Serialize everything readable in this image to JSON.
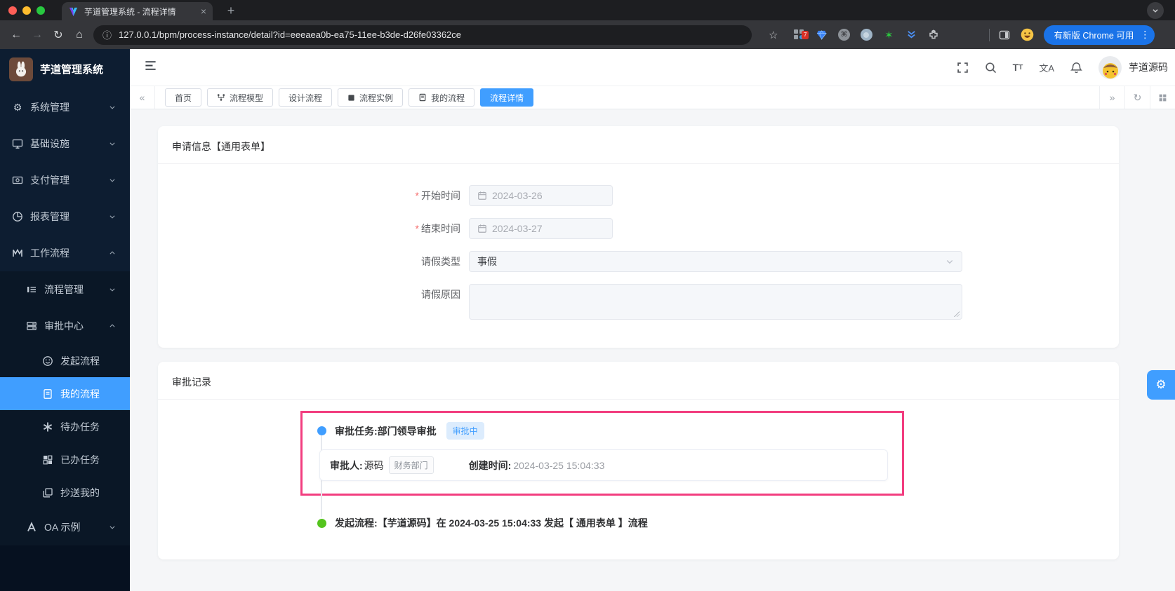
{
  "colors": {
    "accent": "#409eff",
    "highlight_border": "#f23d7f",
    "start_dot": "#55c41e",
    "task_dot": "#409eff",
    "sidebar_bg": "#0d1d31"
  },
  "icons": {
    "back": "←",
    "forward": "→",
    "reload": "↻",
    "home": "⌂",
    "info": "ⓘ",
    "star": "☆",
    "close": "×",
    "plus": "+",
    "kebab": "⋮",
    "chevron_double_left": "«",
    "chevron_double_right": "»",
    "tab_search_chevron": "⌄",
    "green_star": "✶",
    "cmd": "⌘",
    "gear": "⚙",
    "fab_gear": "⚙",
    "refresh": "↻",
    "font_size": "T",
    "font_size_small": "T",
    "translate": "文A"
  },
  "browser": {
    "tab_title": "芋道管理系统 - 流程详情",
    "url": "127.0.0.1/bpm/process-instance/detail?id=eeeaea0b-ea75-11ee-b3de-d26fe03362ce",
    "extension_badge": "7",
    "update_button_label": "有新版 Chrome 可用"
  },
  "sidebar": {
    "title": "芋道管理系统",
    "items": [
      {
        "label": "系统管理"
      },
      {
        "label": "基础设施"
      },
      {
        "label": "支付管理"
      },
      {
        "label": "报表管理"
      },
      {
        "label": "工作流程"
      },
      {
        "label": "流程管理"
      },
      {
        "label": "审批中心"
      },
      {
        "label": "发起流程"
      },
      {
        "label": "我的流程"
      },
      {
        "label": "待办任务"
      },
      {
        "label": "已办任务"
      },
      {
        "label": "抄送我的"
      },
      {
        "label": "OA 示例"
      }
    ]
  },
  "header": {
    "username": "芋道源码"
  },
  "tagsbar": {
    "tabs": [
      {
        "label": "首页"
      },
      {
        "label": "流程模型"
      },
      {
        "label": "设计流程"
      },
      {
        "label": "流程实例"
      },
      {
        "label": "我的流程"
      },
      {
        "label": "流程详情"
      }
    ]
  },
  "form_card": {
    "title": "申请信息【通用表单】",
    "fields": [
      {
        "label": "开始时间",
        "required": true,
        "type": "date",
        "value": "2024-03-26"
      },
      {
        "label": "结束时间",
        "required": true,
        "type": "date",
        "value": "2024-03-27"
      },
      {
        "label": "请假类型",
        "required": false,
        "type": "select",
        "value": "事假"
      },
      {
        "label": "请假原因",
        "required": false,
        "type": "textarea",
        "value": ""
      }
    ]
  },
  "record_card": {
    "title": "审批记录",
    "timeline": [
      {
        "type": "task",
        "title": "审批任务:部门领导审批",
        "status_badge": "审批中",
        "approver_label": "审批人:",
        "approver": "源码",
        "department": "财务部门",
        "created_label": "创建时间:",
        "created_time": "2024-03-25 15:04:33",
        "highlighted": true
      },
      {
        "type": "start",
        "text": "发起流程:【芋道源码】在 2024-03-25 15:04:33 发起【 通用表单 】流程"
      }
    ]
  }
}
